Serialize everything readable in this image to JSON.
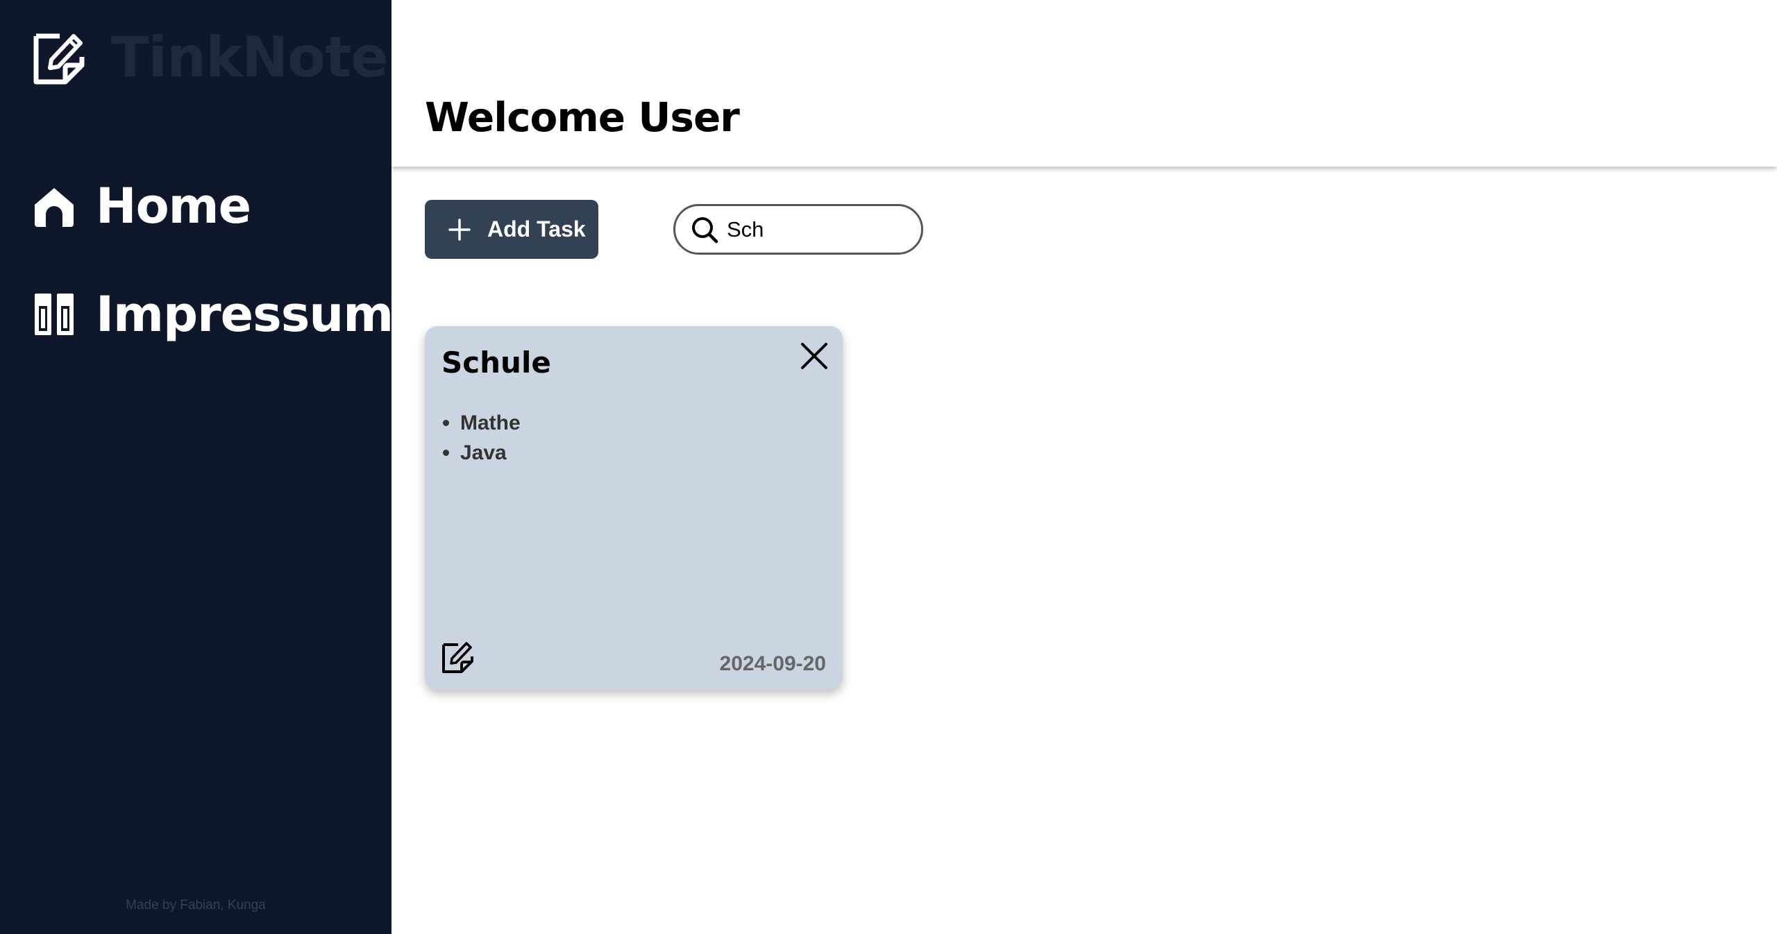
{
  "sidebar": {
    "brand": {
      "name": "TinkNote",
      "icon": "edit-note-icon"
    },
    "items": [
      {
        "label": "Home",
        "icon": "home-icon"
      },
      {
        "label": "Impressum",
        "icon": "book-icon"
      }
    ],
    "credit": "Made by Fabian, Kunga"
  },
  "header": {
    "title": "Welcome User"
  },
  "toolbar": {
    "add_label": "Add Task",
    "search": {
      "value": "Sch",
      "placeholder": ""
    }
  },
  "notes": [
    {
      "title": "Schule",
      "items": [
        "Mathe",
        "Java"
      ],
      "date": "2024-09-20"
    }
  ],
  "colors": {
    "sidebar_bg": "#0f172a",
    "brand_text": "#1e293b",
    "button_bg": "#334155",
    "card_bg": "#cbd5e1"
  }
}
